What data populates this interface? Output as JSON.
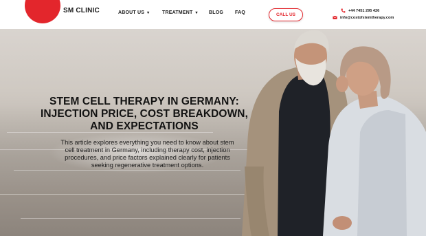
{
  "brand": {
    "name": "SM CLINIC",
    "color": "#e3262c"
  },
  "nav": {
    "items": [
      {
        "label": "ABOUT US",
        "dropdown": true
      },
      {
        "label": "TREATMENT",
        "dropdown": true
      },
      {
        "label": "BLOG",
        "dropdown": false
      },
      {
        "label": "FAQ",
        "dropdown": false
      }
    ],
    "caret": "▾"
  },
  "call_button": {
    "label": "CALL US"
  },
  "contact": {
    "phone": "+44 7451 295 426",
    "email": "info@costofstemtherapy.com",
    "phone_icon": "phone-icon",
    "email_icon": "envelope-icon"
  },
  "hero": {
    "title_lines": [
      "STEM CELL THERAPY IN GERMANY:",
      "INJECTION PRICE, COST BREAKDOWN,",
      "AND EXPECTATIONS"
    ],
    "description_lines": [
      "This article explores everything you need to know about stem",
      "cell treatment in Germany, including therapy cost, injection",
      "procedures, and price factors explained clearly for patients",
      "seeking regenerative treatment options."
    ]
  }
}
